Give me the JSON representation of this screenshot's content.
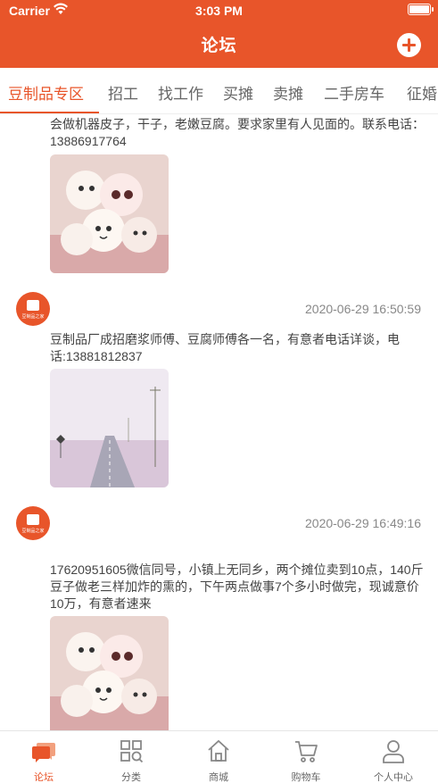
{
  "status_bar": {
    "carrier": "Carrier",
    "time": "3:03 PM"
  },
  "header": {
    "title": "论坛"
  },
  "tabs": [
    "豆制品专区",
    "招工",
    "找工作",
    "买摊",
    "卖摊",
    "二手房车",
    "征婚"
  ],
  "posts": [
    {
      "text": "会做机器皮子，干子，老嫩豆腐。要求家里有人见面的。联系电话：13886917764",
      "image": "marshmallow-image"
    },
    {
      "avatar_label": "豆制品之家",
      "timestamp": "2020-06-29 16:50:59",
      "text": "豆制品厂成招磨浆师傅、豆腐师傅各一名，有意者电话详谈，电话:13881812837",
      "image": "road-image"
    },
    {
      "avatar_label": "豆制品之家",
      "timestamp": "2020-06-29 16:49:16",
      "text": "17620951605微信同号，小镇上无同乡，两个摊位卖到10点，140斤豆子做老三样加炸的熏的，下午两点做事7个多小时做完，现诚意价10万，有意者速来",
      "image": "marshmallow-image"
    }
  ],
  "tabbar": [
    {
      "label": "论坛",
      "icon": "forum-icon"
    },
    {
      "label": "分类",
      "icon": "category-icon"
    },
    {
      "label": "商城",
      "icon": "home-icon"
    },
    {
      "label": "购物车",
      "icon": "cart-icon"
    },
    {
      "label": "个人中心",
      "icon": "user-icon"
    }
  ],
  "colors": {
    "accent": "#e8552a",
    "text": "#444444",
    "muted": "#888888"
  }
}
